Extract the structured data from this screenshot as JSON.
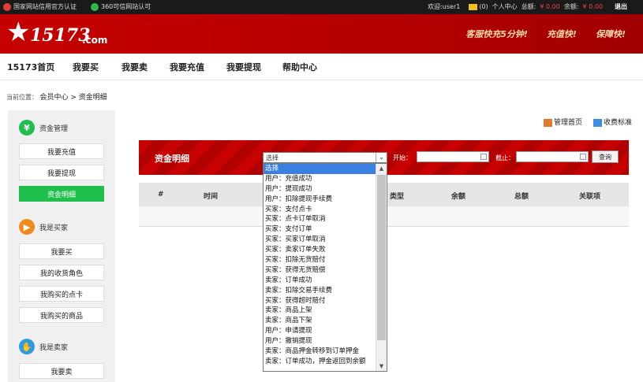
{
  "topbar": {
    "cert1": "国家网站信用官方认证",
    "cert2": "360可信网站认可",
    "welcome": "欢迎:user1",
    "mail": "(0)",
    "personal": "个人中心",
    "total_label": "总额:",
    "total_value": "¥ 0.00",
    "balance_label": "余额:",
    "balance_value": "¥ 0.00",
    "logout": "退出"
  },
  "header": {
    "logo_num": "15173",
    "logo_domain": ".com",
    "slogans": [
      "客服快充5分钟!",
      "充值快!",
      "保障快!"
    ]
  },
  "nav": [
    "15173首页",
    "我要买",
    "我要卖",
    "我要充值",
    "我要提现",
    "帮助中心"
  ],
  "breadcrumb": {
    "prefix": "当前位置：",
    "path": "会员中心 > 资金明细"
  },
  "sidebar": {
    "sections": [
      {
        "title": "资金管理",
        "items": [
          "我要充值",
          "我要提现",
          "资金明细"
        ]
      },
      {
        "title": "我是买家",
        "items": [
          "我要买",
          "我的收货角色",
          "我购买的点卡",
          "我购买的商品"
        ]
      },
      {
        "title": "我是卖家",
        "items": [
          "我要卖"
        ]
      }
    ],
    "active": "资金明细"
  },
  "toplinks": [
    "管理首页",
    "收费标准"
  ],
  "panel": {
    "title": "资金明细",
    "start_label": "开始：",
    "end_label": "截止：",
    "query": "查询"
  },
  "table": {
    "headers": [
      "#",
      "时间",
      "类型",
      "余额",
      "总额",
      "关联项"
    ]
  },
  "select": {
    "value": "选择",
    "options": [
      "选择",
      "用户：充值成功",
      "用户：提现成功",
      "用户：扣除提现手续费",
      "买家：支付点卡",
      "买家：点卡订单取消",
      "买家：支付订单",
      "买家：买家订单取消",
      "买家：卖家订单失败",
      "买家：扣除无货赔付",
      "买家：获得无货赔偿",
      "卖家：订单成功",
      "卖家：扣除交易手续费",
      "买家：获得超时赔付",
      "卖家：商品上架",
      "卖家：商品下架",
      "用户：申请提现",
      "用户：撤销提现",
      "卖家：商品押金转移到订单押金",
      "卖家：订单成功，押金返回到余额"
    ]
  },
  "colors": {
    "brand_red": "#c60000",
    "active_green": "#1fbf4e"
  }
}
